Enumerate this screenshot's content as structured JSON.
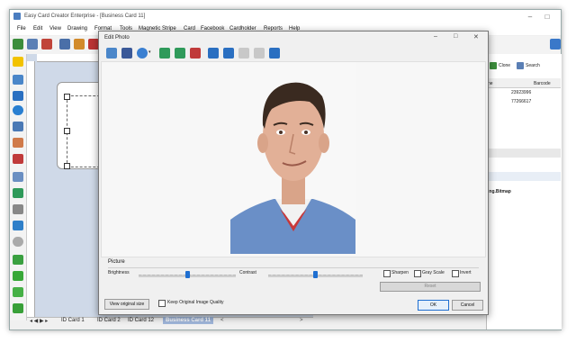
{
  "app": {
    "title": "Easy Card Creator Enterprise - [Business Card 11]",
    "menu": [
      "File",
      "Edit",
      "View",
      "Drawing",
      "Format",
      "Tools",
      "Magnetic Stripe",
      "Card",
      "Facebook",
      "Cardholder",
      "Reports",
      "Help"
    ],
    "window_controls": {
      "minimize": "–",
      "maximize": "□"
    }
  },
  "right_panel": {
    "clone_label": "Clone",
    "search_label": "Search",
    "column_partial": "ne",
    "column_barcode": "Barcode",
    "barcodes": [
      "23923996",
      "77266617"
    ],
    "property_value": "ing.Bitmap"
  },
  "design": {
    "tabs": [
      "ID Card 1",
      "ID Card 2",
      "ID Card 12",
      "Business Card 11"
    ],
    "active_tab": 3
  },
  "dialog": {
    "title": "Edit Photo",
    "controls": {
      "minimize": "–",
      "maximize": "□",
      "close": "✕"
    },
    "picture_label": "Picture",
    "brightness_label": "Brightness",
    "brightness_value": 0.5,
    "contrast_label": "Contrast",
    "contrast_value": 0.5,
    "sharpen_label": "Sharpen",
    "grayscale_label": "Gray Scale",
    "invert_label": "Invert",
    "reset_label": "Reset",
    "view_original_label": "View original size",
    "keep_quality_label": "Keep Original Image Quality",
    "ok_label": "OK",
    "cancel_label": "Cancel"
  },
  "colors": {
    "accent": "#1f6fd1",
    "design_bg": "#cfd9e8",
    "dialog_bg": "#f0f0f0",
    "scrubs": "#6a8fc7"
  }
}
